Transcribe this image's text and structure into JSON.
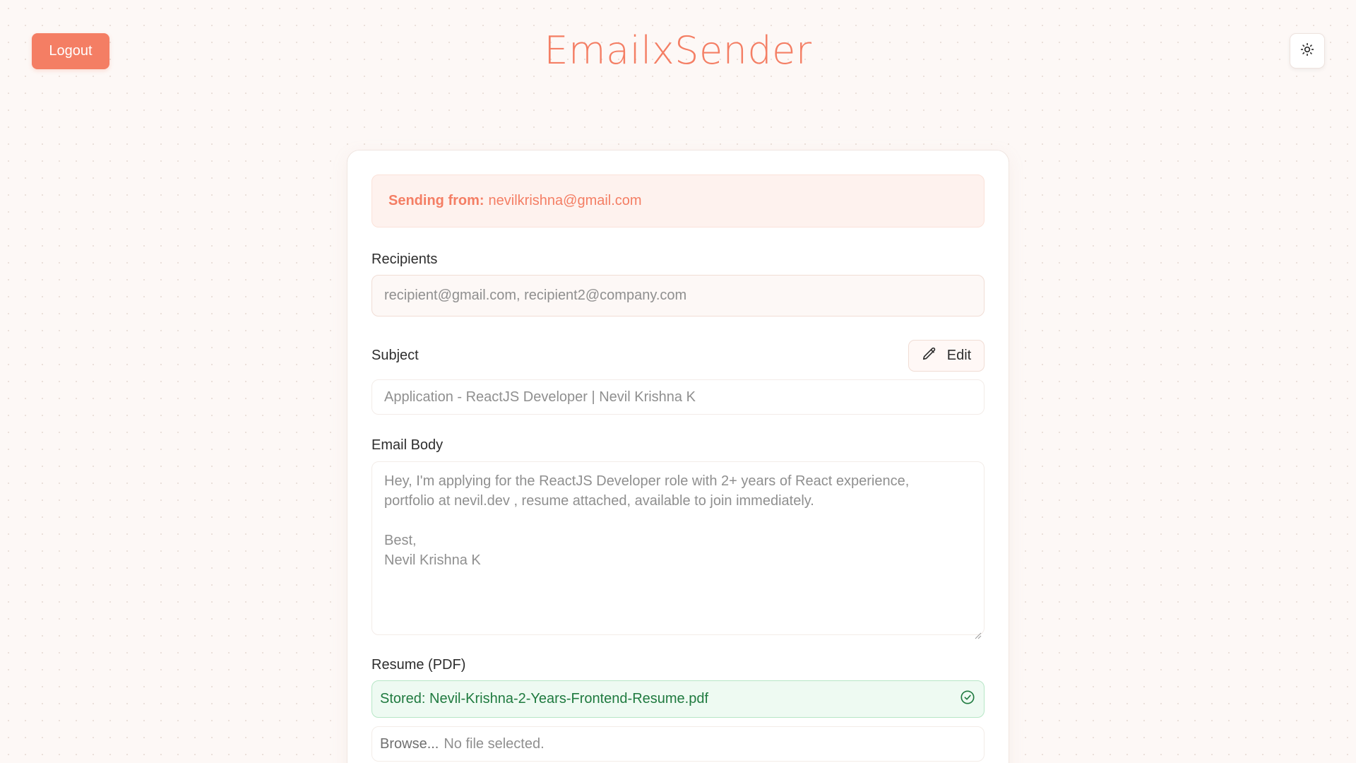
{
  "header": {
    "logout_label": "Logout",
    "app_title": "EmailxSender",
    "theme_toggle_icon": "sun-icon"
  },
  "sender": {
    "label": "Sending from:",
    "email": "nevilkrishna@gmail.com"
  },
  "recipients": {
    "label": "Recipients",
    "placeholder": "recipient@gmail.com, recipient2@company.com"
  },
  "subject": {
    "label": "Subject",
    "edit_label": "Edit",
    "edit_icon": "pencil-icon",
    "value": "Application - ReactJS Developer | Nevil Krishna K"
  },
  "email_body": {
    "label": "Email Body",
    "paragraph1": "Hey, I'm applying for the ReactJS Developer role with 2+ years of React experience,\nportfolio at nevil.dev , resume attached, available to join immediately.",
    "closing": "Best,\nNevil Krishna K"
  },
  "resume": {
    "label": "Resume (PDF)",
    "stored_text": "Stored: Nevil-Krishna-2-Years-Frontend-Resume.pdf",
    "stored_icon": "check-circle-icon",
    "browse_label": "Browse...",
    "no_file_text": "No file selected."
  },
  "colors": {
    "accent": "#f47e64",
    "background": "#fdf8f6",
    "success_bg": "#eefaf2",
    "success_text": "#1f7a3f"
  }
}
